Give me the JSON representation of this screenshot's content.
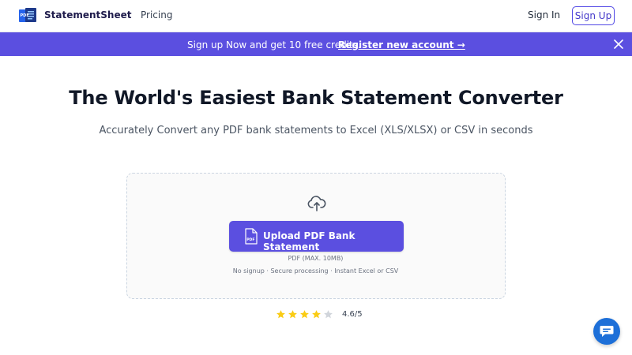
{
  "header": {
    "brand": "StatementSheet",
    "logo_icon": "pdf-document-icon",
    "nav": {
      "pricing": "Pricing"
    },
    "signin": "Sign In",
    "signup": "Sign Up"
  },
  "promo": {
    "text": "Sign up Now and get 10 free credits.",
    "link": "Register new account →",
    "close_icon": "close-icon"
  },
  "hero": {
    "title": "The World's Easiest Bank Statement Converter",
    "subtitle": "Accurately Convert any PDF bank statements to Excel (XLS/XLSX) or CSV in seconds"
  },
  "upload": {
    "icon": "cloud-upload-icon",
    "button_label": "Upload PDF Bank Statement",
    "button_icon": "pdf-file-icon",
    "limit": "PDF (MAX. 10MB)",
    "features": "No signup · Secure processing · Instant Excel or CSV"
  },
  "rating": {
    "value_text": "4.6/5",
    "stars": 5,
    "filled": 4
  },
  "colors": {
    "accent": "#5b4fe0",
    "star": "#facc15",
    "star_empty": "#d1d5db",
    "chat": "#1d6fd8"
  },
  "chat": {
    "icon": "chat-bubble-icon"
  }
}
